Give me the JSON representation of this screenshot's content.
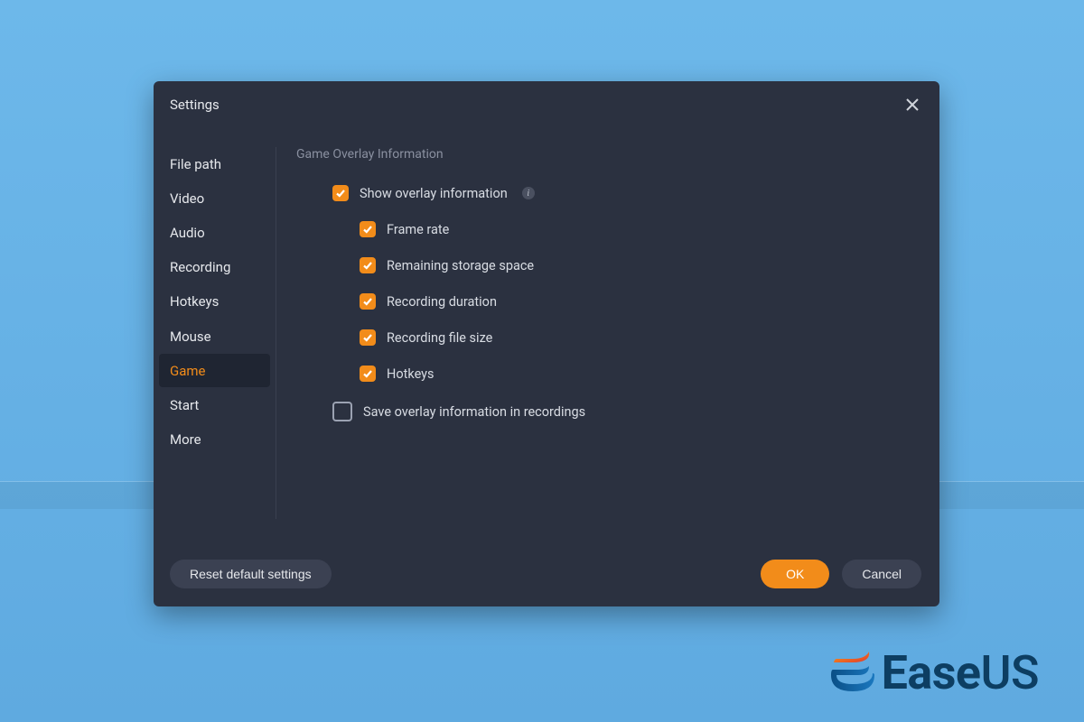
{
  "dialog": {
    "title": "Settings"
  },
  "sidebar": {
    "items": [
      {
        "label": "File path",
        "key": "file-path"
      },
      {
        "label": "Video",
        "key": "video"
      },
      {
        "label": "Audio",
        "key": "audio"
      },
      {
        "label": "Recording",
        "key": "recording"
      },
      {
        "label": "Hotkeys",
        "key": "hotkeys"
      },
      {
        "label": "Mouse",
        "key": "mouse"
      },
      {
        "label": "Game",
        "key": "game",
        "active": true
      },
      {
        "label": "Start",
        "key": "start"
      },
      {
        "label": "More",
        "key": "more"
      }
    ]
  },
  "content": {
    "section_title": "Game Overlay Information",
    "show_overlay": {
      "label": "Show overlay information",
      "checked": true,
      "info": true
    },
    "sub_options": [
      {
        "label": "Frame rate",
        "checked": true,
        "key": "frame-rate"
      },
      {
        "label": "Remaining storage space",
        "checked": true,
        "key": "remaining-storage"
      },
      {
        "label": "Recording duration",
        "checked": true,
        "key": "recording-duration"
      },
      {
        "label": "Recording file size",
        "checked": true,
        "key": "recording-file-size"
      },
      {
        "label": "Hotkeys",
        "checked": true,
        "key": "hotkeys-overlay"
      }
    ],
    "save_overlay": {
      "label": "Save overlay information in recordings",
      "checked": false
    }
  },
  "footer": {
    "reset": "Reset default settings",
    "ok": "OK",
    "cancel": "Cancel"
  },
  "brand": {
    "name_part1": "Ease",
    "name_part2": "US"
  },
  "colors": {
    "accent": "#f28c1a",
    "panel": "#2b3140",
    "panel_dark": "#1f2532",
    "text": "#e6e8ec",
    "muted": "#8a90a0"
  }
}
